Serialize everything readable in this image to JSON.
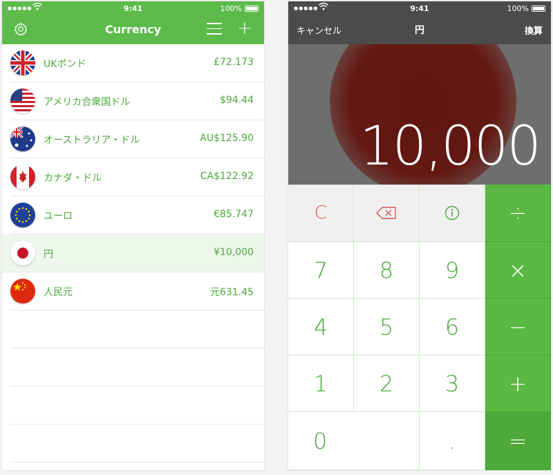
{
  "left_screen": {
    "status": {
      "time": "9:41",
      "battery": "100%"
    },
    "header": {
      "title": "Currency"
    },
    "currencies": [
      {
        "name": "UKポンド",
        "value": "£72.173",
        "flag": "uk-flag"
      },
      {
        "name": "アメリカ合衆国ドル",
        "value": "$94.44",
        "flag": "us-flag"
      },
      {
        "name": "オーストラリア・ドル",
        "value": "AU$125.90",
        "flag": "australia-flag"
      },
      {
        "name": "カナダ・ドル",
        "value": "CA$122.92",
        "flag": "canada-flag"
      },
      {
        "name": "ユーロ",
        "value": "€85.747",
        "flag": "eu-flag"
      },
      {
        "name": "円",
        "value": "¥10,000",
        "flag": "japan-flag",
        "selected": true
      },
      {
        "name": "人民元",
        "value": "元631.45",
        "flag": "china-flag"
      }
    ],
    "colors": {
      "accent": "#5cbb4a",
      "text": "#4aa83a"
    }
  },
  "right_screen": {
    "status": {
      "time": "9:41",
      "battery": "100%"
    },
    "navbar": {
      "cancel": "キャンセル",
      "title": "円",
      "convert": "換算"
    },
    "display": "10,000",
    "keys": {
      "clear": "C",
      "backspace": "backspace-icon",
      "info": "info-icon",
      "divide": "÷",
      "multiply": "×",
      "minus": "−",
      "plus": "+",
      "equals": "=",
      "d7": "7",
      "d8": "8",
      "d9": "9",
      "d4": "4",
      "d5": "5",
      "d6": "6",
      "d1": "1",
      "d2": "2",
      "d3": "3",
      "d0": "0",
      "dot": "."
    },
    "colors": {
      "operator": "#5ab942",
      "clear": "#e05050"
    }
  }
}
